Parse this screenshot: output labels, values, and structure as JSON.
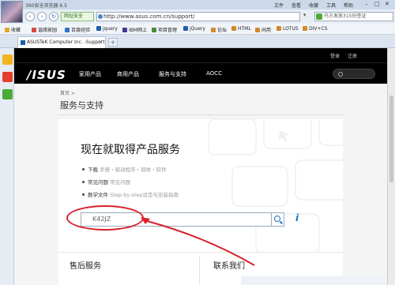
{
  "browser": {
    "title": "360安全浏览器 6.5",
    "menu": [
      "文件",
      "查看",
      "收藏",
      "工具",
      "帮助"
    ],
    "safe_badge": "网址安全",
    "url": "http://www.asus.com.cn/support/",
    "search_placeholder": "马方发放315份签证",
    "favorites": [
      {
        "label": "收藏",
        "color": "#e0a82a"
      },
      {
        "label": "谐缘家园",
        "color": "#d64a3a"
      },
      {
        "label": "百度经验",
        "color": "#2f6fd1"
      },
      {
        "label": "jquery",
        "color": "#1f5fa8"
      },
      {
        "label": "IBM网上",
        "color": "#3b3b8e"
      },
      {
        "label": "项目管理",
        "color": "#4a8b3a"
      },
      {
        "label": "jQuery",
        "color": "#1f5fa8"
      },
      {
        "label": "论坛",
        "color": "#d08a2a"
      },
      {
        "label": "HTML",
        "color": "#d08a2a"
      },
      {
        "label": "闲用",
        "color": "#d08a2a"
      },
      {
        "label": "LOTUS",
        "color": "#d08a2a"
      },
      {
        "label": "DIV+CS",
        "color": "#d08a2a"
      }
    ],
    "tab_title": "ASUSTeK Computer Inc. -Support"
  },
  "site": {
    "top_links": [
      "登录",
      "注册"
    ],
    "logo": "/ISUS",
    "nav": [
      "家用产品",
      "商用产品",
      "服务与支持",
      "AOCC"
    ],
    "breadcrumb": "首页 >",
    "page_title": "服务与支持",
    "hero_title": "现在就取得产品服务",
    "bullets": [
      {
        "main": "下载",
        "sub": "手册・驱动程序・韧体・软件"
      },
      {
        "main": "常见问题",
        "sub": "常见问题"
      },
      {
        "main": "教学文件",
        "sub": "Step-by-step设定与安装指南"
      }
    ],
    "search_value": "K42JZ",
    "info_glyph": "i",
    "after_sales": "售后服务",
    "contact": "联系我们"
  },
  "annotation": {
    "ring_color": "#d8202a"
  }
}
